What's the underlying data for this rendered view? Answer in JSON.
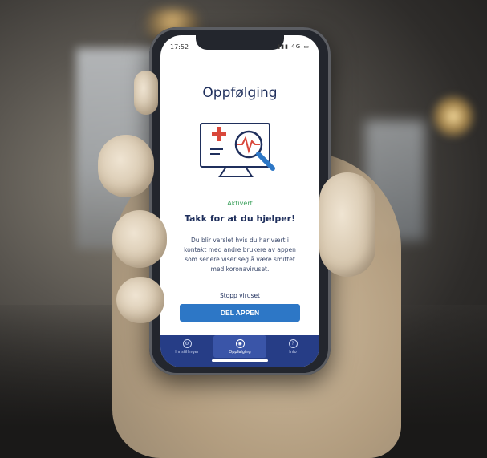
{
  "status_bar": {
    "time": "17:52",
    "network": "4G"
  },
  "screen": {
    "title": "Oppfølging",
    "status_label": "Aktivert",
    "headline": "Takk for at du hjelper!",
    "body_text": "Du blir varslet hvis du har vært i kontakt med andre brukere av appen som senere viser seg å være smittet med koronaviruset.",
    "stop_label": "Stopp viruset",
    "share_button": "DEL APPEN"
  },
  "tabbar": {
    "tabs": [
      {
        "label": "Innstillinger",
        "icon": "gear-icon"
      },
      {
        "label": "Oppfølging",
        "icon": "follow-up-icon",
        "active": true
      },
      {
        "label": "Info",
        "icon": "info-icon"
      }
    ]
  },
  "colors": {
    "navy": "#1f2f5c",
    "accent_blue": "#2d77c6",
    "active_green": "#3aa05a",
    "tabbar": "#263d86",
    "cross_red": "#d9483b"
  }
}
